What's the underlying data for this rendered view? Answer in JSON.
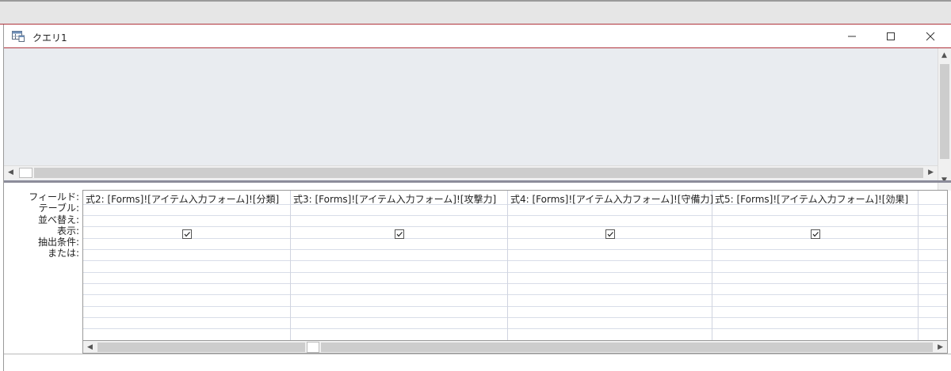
{
  "window": {
    "title": "クエリ1",
    "controls": [
      "minimize",
      "maximize",
      "close"
    ]
  },
  "grid": {
    "row_labels": [
      "フィールド:",
      "テーブル:",
      "並べ替え:",
      "表示:",
      "抽出条件:",
      "または:"
    ],
    "columns": [
      {
        "field": "式2: [Forms]![アイテム入力フォーム]![分類]",
        "show": true
      },
      {
        "field": "式3: [Forms]![アイテム入力フォーム]![攻撃力]",
        "show": true
      },
      {
        "field": "式4: [Forms]![アイテム入力フォーム]![守備力]",
        "show": true
      },
      {
        "field": "式5: [Forms]![アイテム入力フォーム]![効果]",
        "show": true
      }
    ]
  },
  "icons": {
    "title_icon": "query-icon",
    "minimize": "minimize-icon",
    "maximize": "maximize-icon",
    "close": "close-icon"
  }
}
